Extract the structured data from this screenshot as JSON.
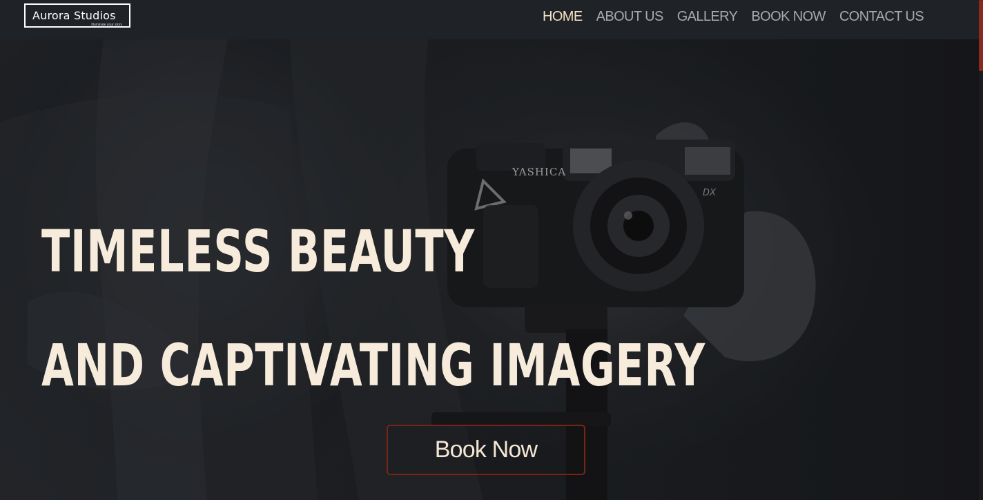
{
  "header": {
    "logo_title": "Aurora Studios",
    "logo_tagline": "Illuminate your story"
  },
  "nav": {
    "items": [
      {
        "label": "HOME",
        "active": true
      },
      {
        "label": "ABOUT US",
        "active": false
      },
      {
        "label": "GALLERY",
        "active": false
      },
      {
        "label": "BOOK NOW",
        "active": false
      },
      {
        "label": "CONTACT US",
        "active": false
      }
    ]
  },
  "hero": {
    "headline_line1": "TIMELESS BEAUTY",
    "headline_line2": "AND CAPTIVATING IMAGERY",
    "cta_label": "Book Now",
    "camera_brand": "YASHICA",
    "camera_model": "DX"
  },
  "colors": {
    "accent": "#f4e3c4",
    "headline": "#f7ecdc",
    "cta_border": "#7a2418",
    "scroll_thumb": "#8a2a1c",
    "header_bg": "#1f2227"
  }
}
